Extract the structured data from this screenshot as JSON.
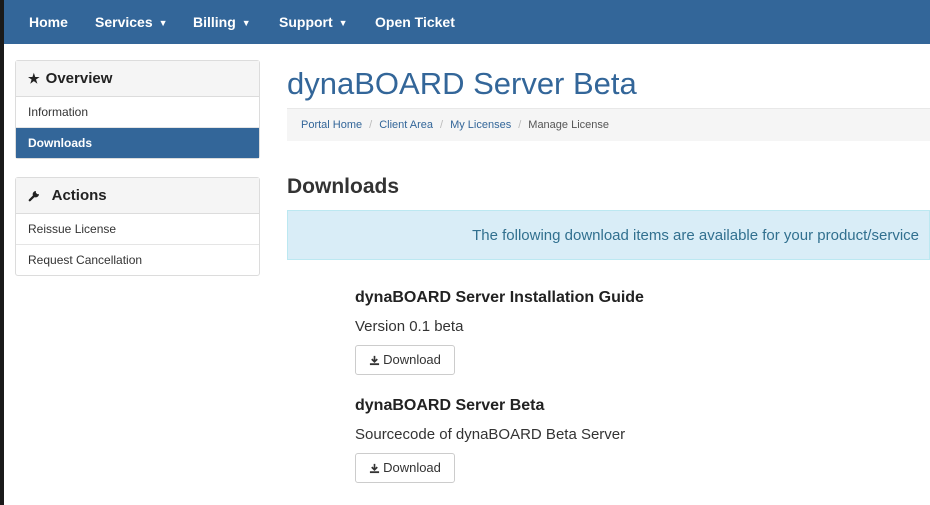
{
  "nav": {
    "items": [
      {
        "label": "Home"
      },
      {
        "label": "Services",
        "dropdown": true
      },
      {
        "label": "Billing",
        "dropdown": true
      },
      {
        "label": "Support",
        "dropdown": true
      },
      {
        "label": "Open Ticket"
      }
    ],
    "background_color": "#336699"
  },
  "sidebar": {
    "overview": {
      "title": "Overview",
      "icon": "star-icon",
      "items": [
        {
          "label": "Information",
          "active": false
        },
        {
          "label": "Downloads",
          "active": true
        }
      ]
    },
    "actions": {
      "title": "Actions",
      "icon": "wrench-icon",
      "items": [
        {
          "label": "Reissue License"
        },
        {
          "label": "Request Cancellation"
        }
      ]
    }
  },
  "main": {
    "title": "dynaBOARD Server Beta",
    "breadcrumb": [
      "Portal Home",
      "Client Area",
      "My Licenses",
      "Manage License"
    ],
    "section_title": "Downloads",
    "info_message": "The following download items are available for your product/service",
    "downloads": [
      {
        "title": "dynaBOARD Server Installation Guide",
        "description": "Version 0.1 beta",
        "button": "Download"
      },
      {
        "title": "dynaBOARD Server Beta",
        "description": "Sourcecode of dynaBOARD Beta Server",
        "button": "Download"
      }
    ]
  },
  "colors": {
    "accent": "#336699",
    "info_background": "#d9edf7",
    "info_text": "#31708f"
  }
}
